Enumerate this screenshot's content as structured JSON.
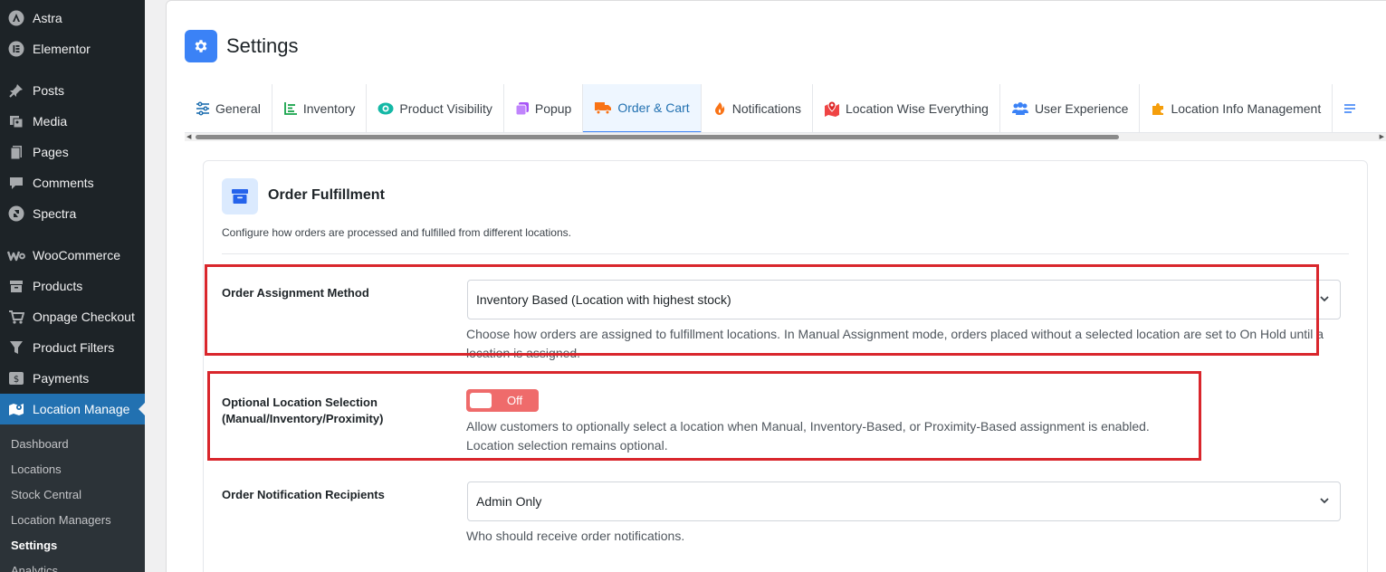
{
  "sidebar": {
    "items": [
      {
        "label": "Astra",
        "icon": "astra-icon"
      },
      {
        "label": "Elementor",
        "icon": "elementor-icon"
      },
      {
        "label": "Posts",
        "icon": "pin-icon"
      },
      {
        "label": "Media",
        "icon": "media-icon"
      },
      {
        "label": "Pages",
        "icon": "pages-icon"
      },
      {
        "label": "Comments",
        "icon": "comment-icon"
      },
      {
        "label": "Spectra",
        "icon": "spectra-icon"
      },
      {
        "label": "WooCommerce",
        "icon": "woocommerce-icon"
      },
      {
        "label": "Products",
        "icon": "products-icon"
      },
      {
        "label": "Onpage Checkout",
        "icon": "cart-icon"
      },
      {
        "label": "Product Filters",
        "icon": "filter-icon"
      },
      {
        "label": "Payments",
        "icon": "payments-icon"
      },
      {
        "label": "Location Manage",
        "icon": "map-icon"
      }
    ],
    "submenu": [
      {
        "label": "Dashboard"
      },
      {
        "label": "Locations"
      },
      {
        "label": "Stock Central"
      },
      {
        "label": "Location Managers"
      },
      {
        "label": "Settings"
      },
      {
        "label": "Analytics"
      }
    ]
  },
  "header": {
    "title": "Settings",
    "icon": "gear-icon",
    "accent": "#3b82f6"
  },
  "tabs": [
    {
      "label": "General",
      "icon": "sliders-icon"
    },
    {
      "label": "Inventory",
      "icon": "chart-icon"
    },
    {
      "label": "Product Visibility",
      "icon": "eye-icon"
    },
    {
      "label": "Popup",
      "icon": "popup-icon"
    },
    {
      "label": "Order & Cart",
      "icon": "truck-icon"
    },
    {
      "label": "Notifications",
      "icon": "bell-icon"
    },
    {
      "label": "Location Wise Everything",
      "icon": "map-marker-icon"
    },
    {
      "label": "User Experience",
      "icon": "users-icon"
    },
    {
      "label": "Location Info Management",
      "icon": "puzzle-icon"
    }
  ],
  "card": {
    "title": "Order Fulfillment",
    "icon": "archive-icon",
    "description": "Configure how orders are processed and fulfilled from different locations.",
    "fields": {
      "assignment": {
        "label": "Order Assignment Method",
        "value": "Inventory Based (Location with highest stock)",
        "help_line1": "Choose how orders are assigned to fulfillment locations. In Manual Assignment mode, orders placed without a selected location are set to On Hold until a",
        "help_line2": "location is assigned."
      },
      "optional_location": {
        "label_line1": "Optional Location Selection",
        "label_line2": "(Manual/Inventory/Proximity)",
        "toggle": "Off",
        "help_line1": "Allow customers to optionally select a location when Manual, Inventory-Based, or Proximity-Based assignment is enabled.",
        "help_line2": "Location selection remains optional."
      },
      "recipients": {
        "label": "Order Notification Recipients",
        "value": "Admin Only",
        "help": "Who should receive order notifications."
      }
    }
  },
  "colors": {
    "highlight": "#d9262c",
    "toggle_off": "#ef6b6b",
    "sidebar_bg": "#1d2327",
    "active_menu": "#2271b1"
  }
}
